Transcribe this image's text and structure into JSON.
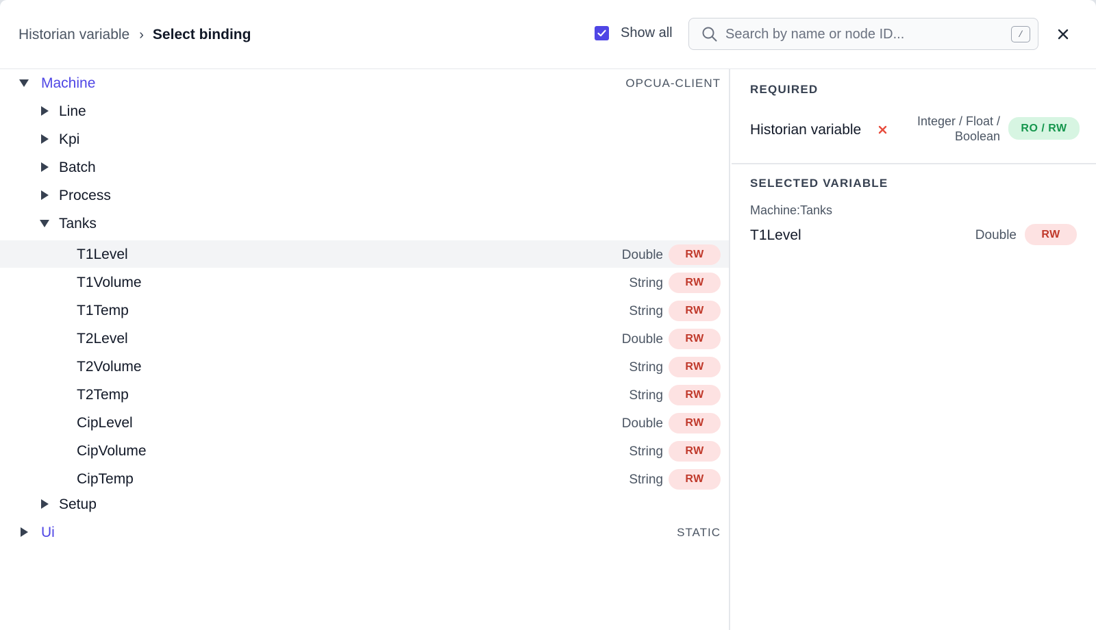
{
  "header": {
    "breadcrumb_parent": "Historian variable",
    "breadcrumb_separator": "›",
    "breadcrumb_current": "Select binding",
    "show_all_label": "Show all",
    "show_all_checked": true,
    "search_placeholder": "Search by name or node ID...",
    "search_shortcut": "/",
    "close_icon": "close-icon"
  },
  "tree": {
    "roots": [
      {
        "label": "Machine",
        "source": "OPCUA-CLIENT",
        "expanded": true,
        "children": [
          {
            "label": "Line",
            "expanded": false
          },
          {
            "label": "Kpi",
            "expanded": false
          },
          {
            "label": "Batch",
            "expanded": false
          },
          {
            "label": "Process",
            "expanded": false
          },
          {
            "label": "Tanks",
            "expanded": true,
            "variables": [
              {
                "label": "T1Level",
                "type": "Double",
                "access": "RW",
                "selected": true
              },
              {
                "label": "T1Volume",
                "type": "String",
                "access": "RW"
              },
              {
                "label": "T1Temp",
                "type": "String",
                "access": "RW"
              },
              {
                "label": "T2Level",
                "type": "Double",
                "access": "RW"
              },
              {
                "label": "T2Volume",
                "type": "String",
                "access": "RW"
              },
              {
                "label": "T2Temp",
                "type": "String",
                "access": "RW"
              },
              {
                "label": "CipLevel",
                "type": "Double",
                "access": "RW"
              },
              {
                "label": "CipVolume",
                "type": "String",
                "access": "RW"
              },
              {
                "label": "CipTemp",
                "type": "String",
                "access": "RW"
              }
            ]
          },
          {
            "label": "Setup",
            "expanded": false
          }
        ]
      },
      {
        "label": "Ui",
        "source": "STATIC",
        "expanded": false
      }
    ]
  },
  "required": {
    "title": "REQUIRED",
    "name": "Historian variable",
    "missing_icon": "x-icon",
    "types_line1": "Integer / Float /",
    "types_line2": "Boolean",
    "access": "RO / RW"
  },
  "selected": {
    "title": "SELECTED VARIABLE",
    "path": "Machine:Tanks",
    "name": "T1Level",
    "type": "Double",
    "access": "RW"
  },
  "colors": {
    "accent": "#4f46e5",
    "rw_badge_bg": "#fde2e2",
    "rw_badge_text": "#c0392b",
    "rorw_badge_bg": "#d7f5e2",
    "rorw_badge_text": "#15964d",
    "error": "#e74c3c"
  }
}
